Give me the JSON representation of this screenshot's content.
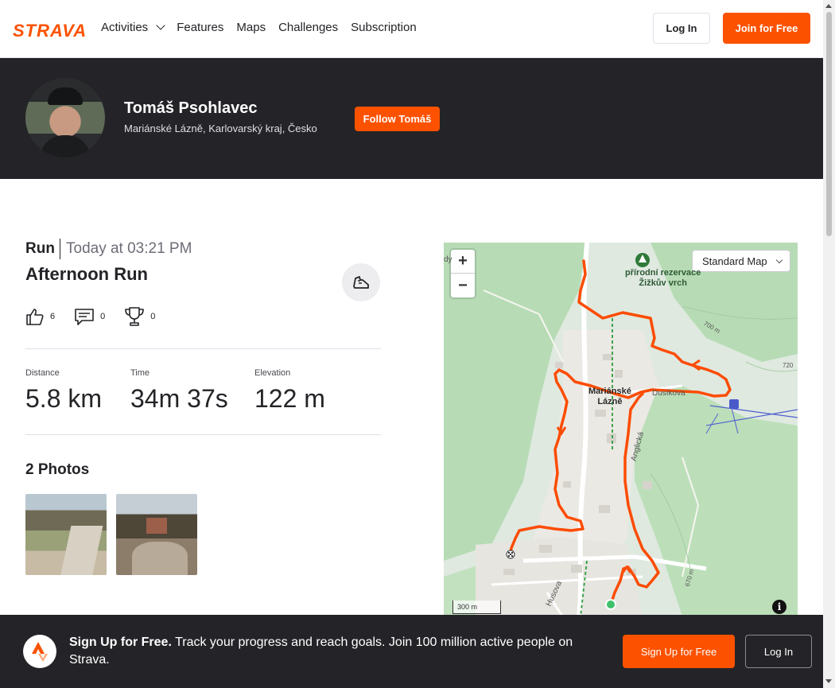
{
  "nav": {
    "logo": "STRAVA",
    "links": [
      "Activities",
      "Features",
      "Maps",
      "Challenges",
      "Subscription"
    ],
    "login": "Log In",
    "join": "Join for Free"
  },
  "athlete": {
    "name": "Tomáš Psohlavec",
    "location": "Mariánské Lázně, Karlovarský kraj, Česko",
    "follow": "Follow Tomáš"
  },
  "activity": {
    "type": "Run",
    "time": "Today at 03:21 PM",
    "title": "Afternoon Run",
    "kudos": "6",
    "comments": "0",
    "achievements": "0",
    "stats": [
      {
        "label": "Distance",
        "value": "5.8 km"
      },
      {
        "label": "Time",
        "value": "34m 37s"
      },
      {
        "label": "Elevation",
        "value": "122 m"
      }
    ],
    "photos_title": "2 Photos"
  },
  "map": {
    "style": "Standard Map",
    "scale": "300 m",
    "labels": {
      "reserve": "přírodní rezervace\nŽižkův vrch",
      "town": "Mariánské\nLázně",
      "street1": "Dusíkova",
      "street2": "Anglická",
      "street3": "Husova",
      "c700": "700 m",
      "c720": "720",
      "c670": "670 m",
      "edge": "dy"
    }
  },
  "banner": {
    "headline": "Sign Up for Free.",
    "text": " Track your progress and reach goals. Join 100 million active people on Strava.",
    "signup": "Sign Up for Free",
    "login": "Log In"
  },
  "colors": {
    "brand": "#fc5200",
    "dark": "#242428",
    "route": "#fc4c02"
  }
}
